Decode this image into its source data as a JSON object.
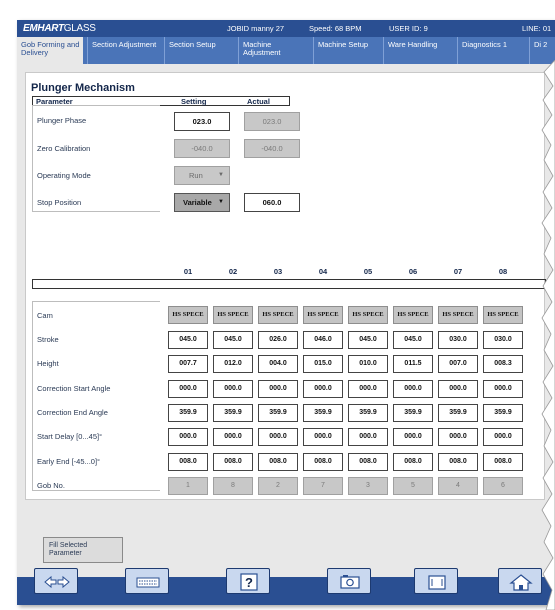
{
  "topbar": {
    "logo_bold": "EMHART",
    "logo_thin": "GLASS",
    "job": "JOBID manny 27",
    "speed": "Speed: 68 BPM",
    "user": "USER ID: 9",
    "line": "LINE: 01"
  },
  "tabs": [
    {
      "label": "Gob Forming and Delivery",
      "active": true
    },
    {
      "label": "Section Adjustment"
    },
    {
      "label": "Section Setup"
    },
    {
      "label": "Machine Adjustment"
    },
    {
      "label": "Machine Setup"
    },
    {
      "label": "Ware Handling"
    },
    {
      "label": "Diagnostics 1"
    },
    {
      "label": "Di 2"
    }
  ],
  "mechanism": {
    "title": "Plunger Mechanism",
    "header_parameter": "Parameter",
    "header_setting": "Setting",
    "header_actual": "Actual",
    "rows": [
      {
        "label": "Plunger Phase",
        "setting": "023.0",
        "actual": "023.0"
      },
      {
        "label": "Zero Calibration",
        "setting": "-040.0",
        "actual": "-040.0"
      },
      {
        "label": "Operating Mode",
        "setting": "Run"
      },
      {
        "label": "Stop Position",
        "setting": "Variable",
        "actual": "060.0"
      }
    ]
  },
  "grid": {
    "columns": [
      "01",
      "02",
      "03",
      "04",
      "05",
      "06",
      "07",
      "08"
    ],
    "rows": [
      {
        "label": "Cam",
        "values": [
          "HS SPECE",
          "HS SPECE",
          "HS SPECE",
          "HS SPECE",
          "HS SPECE",
          "HS SPECE",
          "HS SPECE",
          "HS SPECE"
        ]
      },
      {
        "label": "Stroke",
        "values": [
          "045.0",
          "045.0",
          "026.0",
          "046.0",
          "045.0",
          "045.0",
          "030.0",
          "030.0"
        ]
      },
      {
        "label": "Height",
        "values": [
          "007.7",
          "012.0",
          "004.0",
          "015.0",
          "010.0",
          "011.5",
          "007.0",
          "008.3"
        ]
      },
      {
        "label": "Correction Start Angle",
        "values": [
          "000.0",
          "000.0",
          "000.0",
          "000.0",
          "000.0",
          "000.0",
          "000.0",
          "000.0"
        ]
      },
      {
        "label": "Correction End Angle",
        "values": [
          "359.9",
          "359.9",
          "359.9",
          "359.9",
          "359.9",
          "359.9",
          "359.9",
          "359.9"
        ]
      },
      {
        "label": "Start Delay [0...45]°",
        "values": [
          "000.0",
          "000.0",
          "000.0",
          "000.0",
          "000.0",
          "000.0",
          "000.0",
          "000.0"
        ]
      },
      {
        "label": "Early End [-45...0]°",
        "values": [
          "008.0",
          "008.0",
          "008.0",
          "008.0",
          "008.0",
          "008.0",
          "008.0",
          "008.0"
        ]
      },
      {
        "label": "Gob No.",
        "values": [
          "1",
          "8",
          "2",
          "7",
          "3",
          "5",
          "4",
          "6"
        ]
      }
    ]
  },
  "fill_button": "Fill Selected Parameter",
  "bottom_buttons": [
    {
      "icon": "swap-arrows-icon"
    },
    {
      "icon": "keyboard-icon"
    },
    {
      "icon": "help-icon",
      "glyph": "?"
    },
    {
      "icon": "camera-icon"
    },
    {
      "icon": "window-icon"
    },
    {
      "icon": "home-icon"
    }
  ],
  "colors": {
    "header_blue": "#2a4f92",
    "tab_blue": "#4a74b8",
    "button_face": "#c9d8ef"
  }
}
